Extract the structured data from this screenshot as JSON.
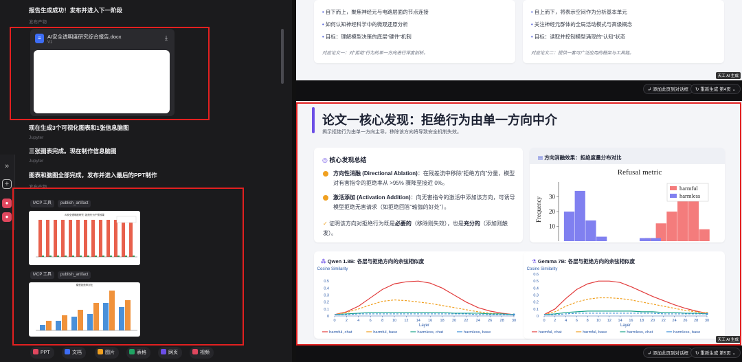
{
  "chat": {
    "msg1": "报告生成成功！发布并进入下一阶段",
    "msg1_sub": "发布产物",
    "file": {
      "name": "AI安全透明度研究综合报告.docx",
      "version": "V1"
    },
    "msg2": "现在生成3个可视化图表和1张信息脑图",
    "msg2_sub": "Jupyter",
    "msg3": "三张图表完成。现在制作信息脑图",
    "msg3_sub": "Jupyter",
    "msg4": "图表和脑图全部完成，发布并进入最后的PPT制作",
    "msg4_sub": "发布产物",
    "tool_tag": "MCP 工具",
    "artifact_tag": "publish_artifact",
    "thumb1_title": "AI安全透明度研究: 拒绝行为干预效果",
    "thumb2_title": "模型拒绝率对比",
    "bottom": [
      "PPT",
      "文档",
      "图片",
      "表格",
      "网页",
      "视频"
    ],
    "bottom_colors": [
      "#e0475e",
      "#3d6df5",
      "#f0a020",
      "#1fa463",
      "#6b4ee6",
      "#e0475e"
    ]
  },
  "slideA": {
    "left_bullets": [
      "自下而上，聚焦神经元与电路层面的节点连接",
      "如何认知神经科学中的微观还原分析",
      "目标：理解模型决策的底层“硬件”机制"
    ],
    "left_note": "对应论文一：对“拒绝”行为的单一方向进行深度剖析。",
    "right_bullets": [
      "自上而下，将表示空间作为分析基本单元",
      "关注神经元群体的全局活动模式与高级概念",
      "目标：读取并控制模型涌现的“认知”状态"
    ],
    "right_note": "对应论文二：提供一套可广泛应用的框架与工具链。",
    "watermark": "天工 AI 生成"
  },
  "controls1": {
    "add": "添加此页到对话框",
    "regen": "重新生成 第4页"
  },
  "controls2": {
    "add": "添加此页到对话框",
    "regen": "重新生成 第5页"
  },
  "slideB": {
    "title": "论文一核心发现：拒绝行为由单一方向中介",
    "subtitle": "揭示拒绝行为由单一方向主导，移除该方向将导致安全机制失效。",
    "findings_title": "核心发现总结",
    "f1_label": "方向性消融 (Directional Ablation)",
    "f1_text": "：在残差流中移除“拒绝方向”分量，模型对有害指令的拒绝率从 >95% 骤降至接近 0%。",
    "f2_label": "激活添加 (Activation Addition)",
    "f2_text": "：向无害指令的激活中添加该方向，可诱导模型拒绝无害请求（如拒绝回答“瑜伽的好处”）。",
    "f3_pre": "证明该方向对拒绝行为既是",
    "f3_b1": "必要的",
    "f3_mid": "（移除则失效），也是",
    "f3_b2": "充分的",
    "f3_post": "（添加则触发）。",
    "hist_title": "方向消融效果：拒绝度量分布对比",
    "watermark": "天工 AI 生成"
  },
  "chart_data": [
    {
      "type": "bar",
      "title": "Refusal metric",
      "ylabel": "Frequency",
      "ylim": [
        0,
        40
      ],
      "yticks": [
        10,
        20,
        30
      ],
      "series": [
        {
          "name": "harmful",
          "color": "#f47c7c",
          "bins": [
            [
              -16.5,
              2
            ],
            [
              -15.5,
              12
            ],
            [
              -14.5,
              20
            ],
            [
              -13.5,
              30
            ],
            [
              -12.5,
              27
            ],
            [
              -11.5,
              8
            ]
          ]
        },
        {
          "name": "harmless",
          "color": "#8080f0",
          "bins": [
            [
              -24,
              20
            ],
            [
              -23,
              34
            ],
            [
              -22,
              14
            ],
            [
              -21,
              3
            ],
            [
              -17,
              2
            ],
            [
              -16,
              2
            ]
          ]
        }
      ]
    },
    {
      "type": "line",
      "title": "Qwen 1.8B: 各层与拒绝方向的余弦相似度",
      "ylabel": "Cosine Similarity",
      "xlabel": "Layer",
      "x": [
        0,
        2,
        4,
        6,
        8,
        10,
        12,
        14,
        16,
        18,
        20,
        22,
        24,
        26,
        28,
        30
      ],
      "ylim": [
        0,
        0.6
      ],
      "yticks": [
        0,
        0.1,
        0.2,
        0.3,
        0.4,
        0.5
      ],
      "series": [
        {
          "name": "harmful, chat",
          "color": "#e23b3b",
          "dash": "",
          "values": [
            0.02,
            0.06,
            0.14,
            0.26,
            0.38,
            0.46,
            0.49,
            0.5,
            0.47,
            0.4,
            0.3,
            0.2,
            0.12,
            0.07,
            0.04,
            0.02
          ]
        },
        {
          "name": "harmful, base",
          "color": "#f0a020",
          "dash": "3,2",
          "values": [
            0.02,
            0.05,
            0.1,
            0.16,
            0.21,
            0.23,
            0.22,
            0.2,
            0.18,
            0.15,
            0.12,
            0.09,
            0.06,
            0.04,
            0.03,
            0.02
          ]
        },
        {
          "name": "harmless, chat",
          "color": "#1aa38a",
          "dash": "",
          "values": [
            0.02,
            0.03,
            0.04,
            0.05,
            0.05,
            0.05,
            0.05,
            0.05,
            0.05,
            0.05,
            0.04,
            0.04,
            0.04,
            0.03,
            0.03,
            0.02
          ]
        },
        {
          "name": "harmless, base",
          "color": "#3b8fd8",
          "dash": "3,2",
          "values": [
            0.02,
            0.02,
            0.03,
            0.03,
            0.03,
            0.03,
            0.03,
            0.03,
            0.03,
            0.03,
            0.03,
            0.03,
            0.02,
            0.02,
            0.02,
            0.02
          ]
        }
      ]
    },
    {
      "type": "line",
      "title": "Gemma 7B: 各层与拒绝方向的余弦相似度",
      "ylabel": "Cosine Similarity",
      "xlabel": "Layer",
      "x": [
        0,
        2,
        4,
        6,
        8,
        10,
        12,
        14,
        16,
        18,
        20,
        22,
        24,
        26,
        28,
        30
      ],
      "ylim": [
        0,
        0.6
      ],
      "yticks": [
        0,
        0.1,
        0.2,
        0.3,
        0.4,
        0.5,
        0.6
      ],
      "series": [
        {
          "name": "harmful, chat",
          "color": "#e23b3b",
          "dash": "",
          "values": [
            0.02,
            0.1,
            0.25,
            0.38,
            0.46,
            0.5,
            0.5,
            0.48,
            0.42,
            0.35,
            0.28,
            0.22,
            0.16,
            0.11,
            0.07,
            0.04
          ]
        },
        {
          "name": "harmful, base",
          "color": "#f0a020",
          "dash": "3,2",
          "values": [
            0.02,
            0.06,
            0.14,
            0.2,
            0.24,
            0.26,
            0.26,
            0.25,
            0.23,
            0.2,
            0.17,
            0.14,
            0.11,
            0.08,
            0.06,
            0.04
          ]
        },
        {
          "name": "harmless, chat",
          "color": "#1aa38a",
          "dash": "",
          "values": [
            0.02,
            0.03,
            0.05,
            0.06,
            0.07,
            0.07,
            0.07,
            0.07,
            0.07,
            0.06,
            0.06,
            0.05,
            0.05,
            0.04,
            0.04,
            0.03
          ]
        },
        {
          "name": "harmless, base",
          "color": "#3b8fd8",
          "dash": "3,2",
          "values": [
            0.02,
            0.02,
            0.03,
            0.04,
            0.04,
            0.04,
            0.04,
            0.04,
            0.04,
            0.04,
            0.04,
            0.03,
            0.03,
            0.03,
            0.03,
            0.03
          ]
        }
      ]
    }
  ]
}
